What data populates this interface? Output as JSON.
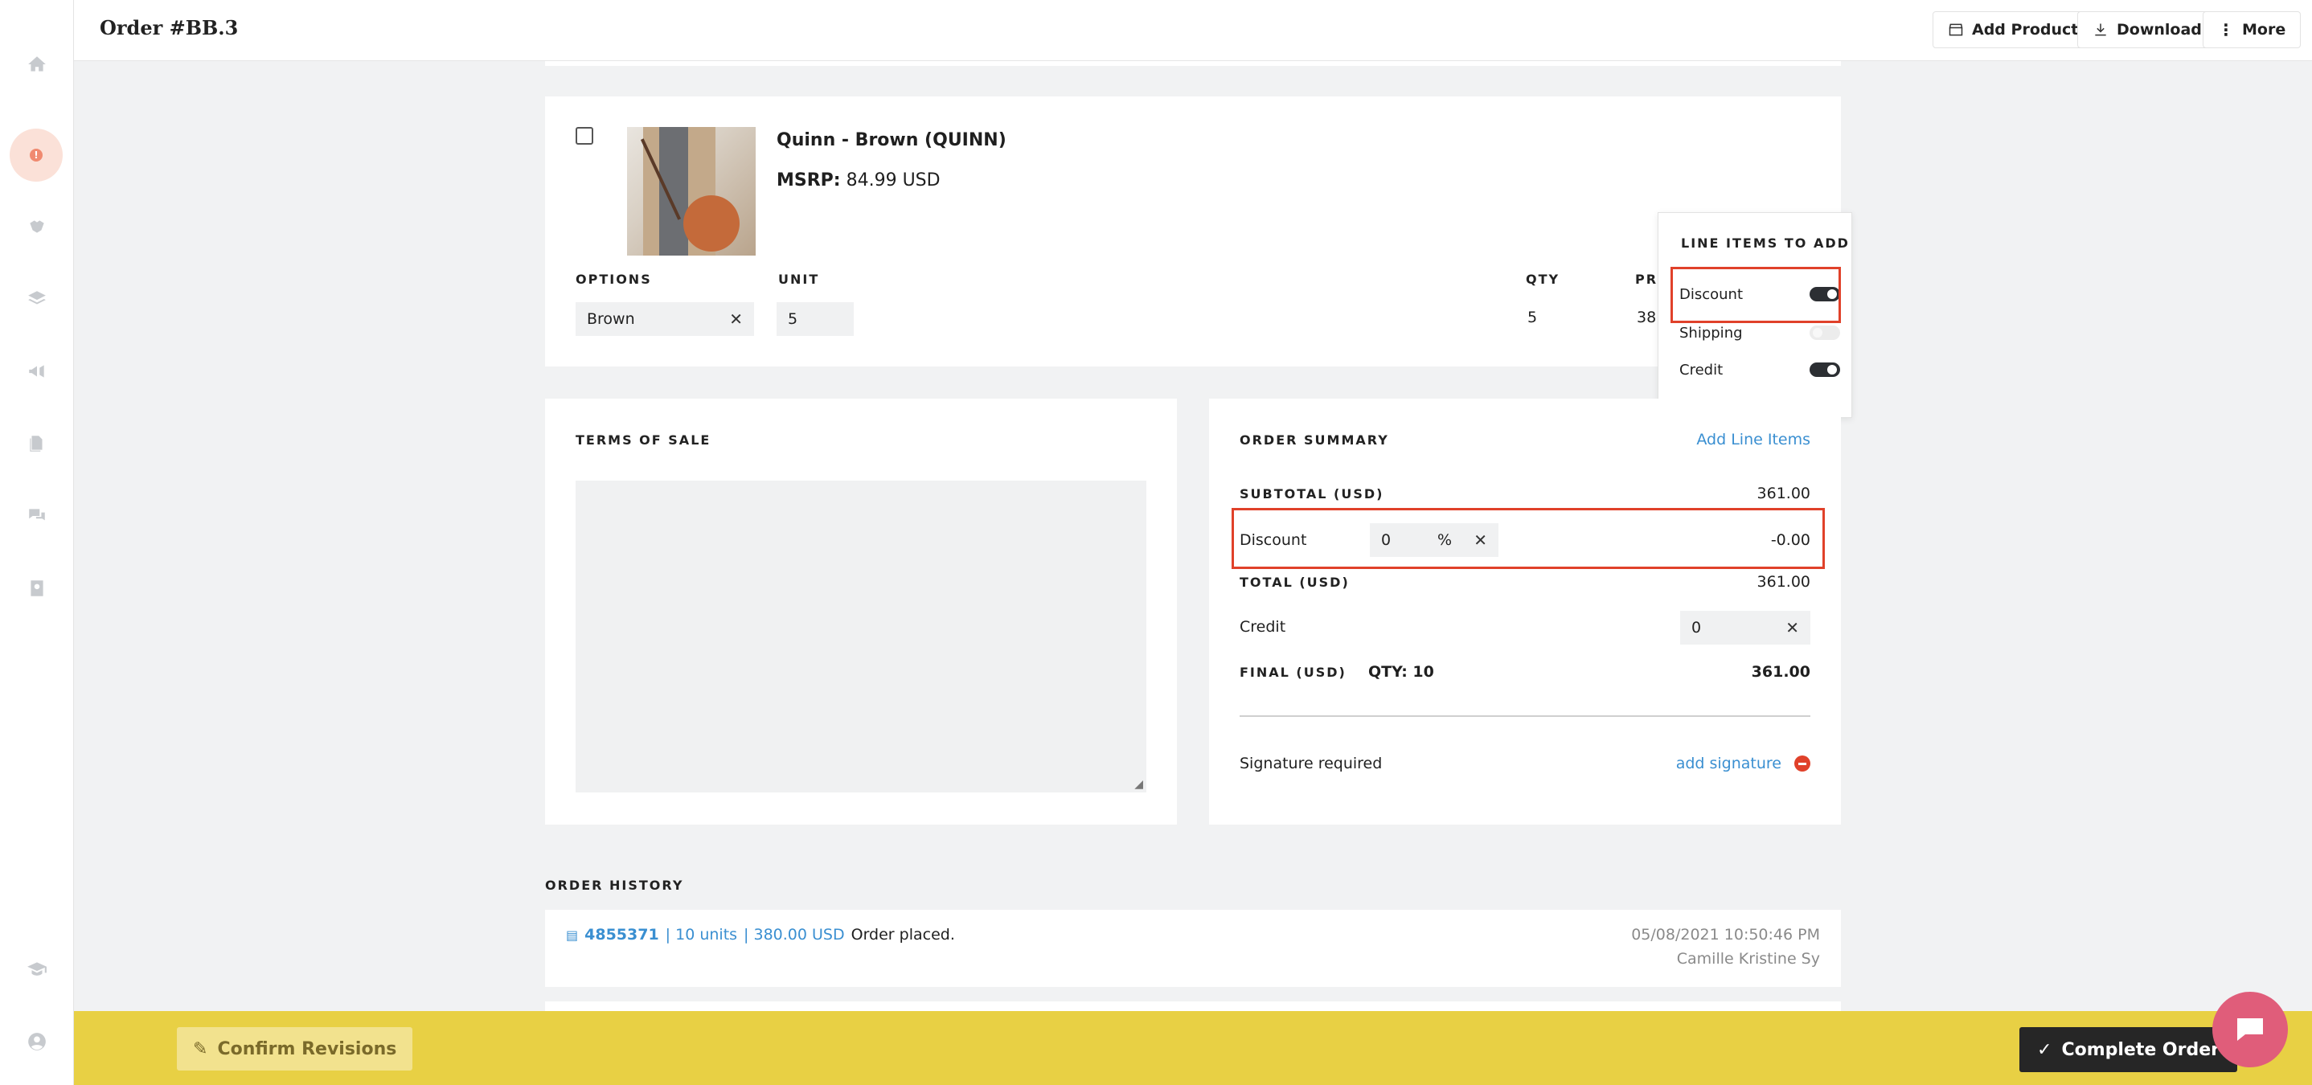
{
  "header": {
    "title": "Order #BB.3",
    "buttons": {
      "add_product": "Add Product",
      "download": "Download",
      "more": "More"
    }
  },
  "sidebar": {
    "items": [
      "home-icon",
      "alert-icon",
      "handshake-icon",
      "layers-icon",
      "megaphone-icon",
      "files-icon",
      "chat-icon",
      "contacts-icon",
      "graduation-icon",
      "account-icon"
    ],
    "alert_badge": "!"
  },
  "product": {
    "name": "Quinn - Brown (QUINN)",
    "msrp_label": "MSRP:",
    "msrp_value": "84.99 USD",
    "headers": {
      "options": "OPTIONS",
      "unit": "UNIT",
      "qty": "QTY",
      "price": "PR"
    },
    "option_value": "Brown",
    "unit_value": "5",
    "qty_value": "5",
    "price_partial": "38"
  },
  "line_items_popover": {
    "title": "LINE ITEMS TO ADD",
    "items": [
      {
        "label": "Discount",
        "enabled": true
      },
      {
        "label": "Shipping",
        "enabled": false
      },
      {
        "label": "Credit",
        "enabled": true
      }
    ]
  },
  "terms": {
    "title": "TERMS OF SALE"
  },
  "summary": {
    "title": "ORDER SUMMARY",
    "add_line_items": "Add Line Items",
    "subtotal_label": "SUBTOTAL (USD)",
    "subtotal_value": "361.00",
    "discount_label": "Discount",
    "discount_input": "0",
    "discount_unit": "%",
    "discount_value": "-0.00",
    "total_label": "TOTAL (USD)",
    "total_value": "361.00",
    "credit_label": "Credit",
    "credit_input": "0",
    "final_label": "FINAL (USD)",
    "final_qty": "QTY: 10",
    "final_value": "361.00",
    "signature_label": "Signature required",
    "add_signature": "add signature"
  },
  "history": {
    "title": "ORDER HISTORY",
    "entries": [
      {
        "id": "4855371",
        "units": "| 10 units",
        "amount": "| 380.00 USD",
        "text": "Order placed.",
        "date": "05/08/2021 10:50:46 PM",
        "user": "Camille Kristine Sy"
      }
    ]
  },
  "footer": {
    "confirm": "Confirm Revisions",
    "complete": "Complete Order"
  },
  "colors": {
    "accent": "#3a8fd1",
    "footer_bg": "#e8d044",
    "highlight": "#e0412a"
  }
}
